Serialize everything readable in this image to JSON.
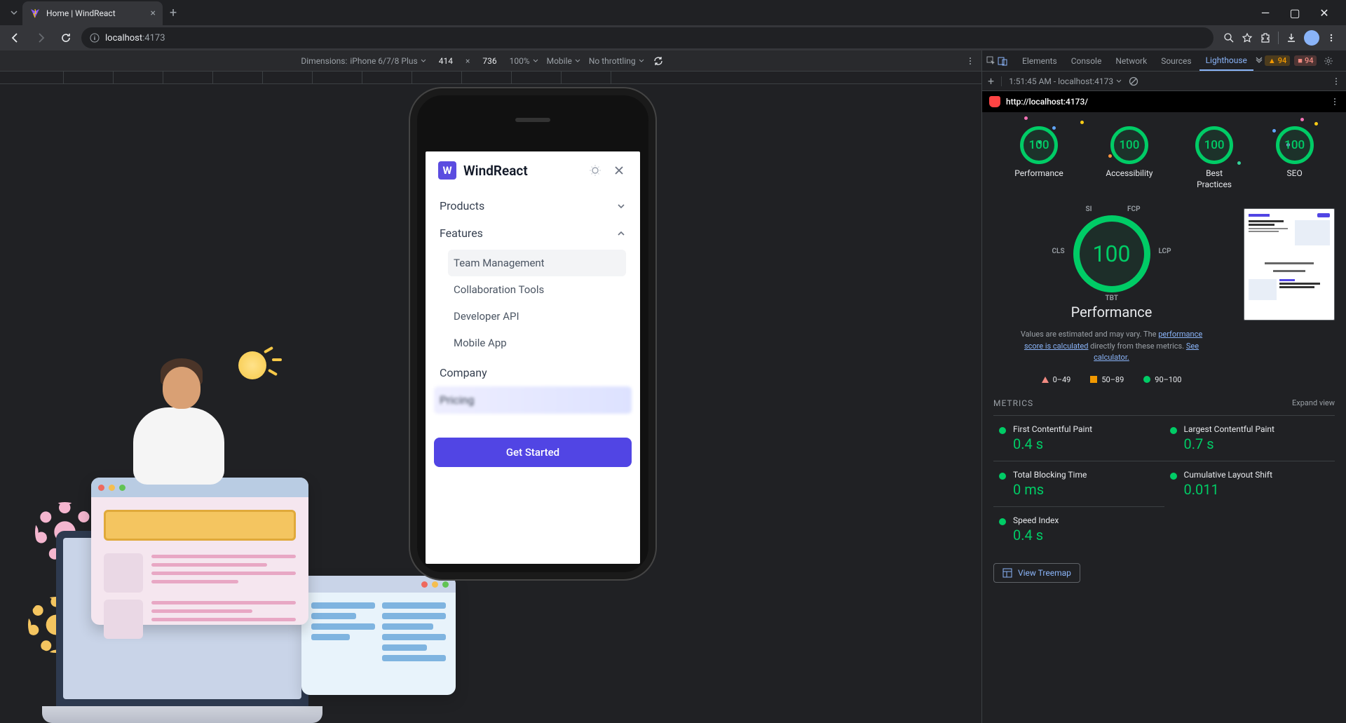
{
  "browser": {
    "tab_title": "Home | WindReact",
    "url_host": "localhost",
    "url_port": ":4173"
  },
  "device_toolbar": {
    "dimensions_label": "Dimensions:",
    "device": "iPhone 6/7/8 Plus",
    "width": "414",
    "height": "736",
    "zoom": "100%",
    "device_type": "Mobile",
    "throttling": "No throttling"
  },
  "app": {
    "logo_letter": "W",
    "name": "WindReact",
    "menu": {
      "products": "Products",
      "features": "Features",
      "features_sub": {
        "team": "Team Management",
        "collab": "Collaboration Tools",
        "api": "Developer API",
        "mobile": "Mobile App"
      },
      "company": "Company",
      "pricing": "Pricing"
    },
    "cta": "Get Started"
  },
  "devtools": {
    "tabs": {
      "elements": "Elements",
      "console": "Console",
      "network": "Network",
      "sources": "Sources",
      "lighthouse": "Lighthouse"
    },
    "warn_count": "94",
    "err_count": "94",
    "lh_timestamp": "1:51:45 AM - localhost:4173",
    "lh_url": "http://localhost:4173/"
  },
  "lighthouse": {
    "gauges": {
      "performance": {
        "score": "100",
        "label": "Performance"
      },
      "accessibility": {
        "score": "100",
        "label": "Accessibility"
      },
      "best_practices": {
        "score": "100",
        "label": "Best\nPractices"
      },
      "seo": {
        "score": "100",
        "label": "SEO"
      }
    },
    "big_gauge_score": "100",
    "big_gauge_title": "Performance",
    "axis": {
      "si": "SI",
      "fcp": "FCP",
      "cls": "CLS",
      "lcp": "LCP",
      "tbt": "TBT"
    },
    "desc_pre": "Values are estimated and may vary. The ",
    "desc_link1": "performance score is calculated",
    "desc_mid": " directly from these metrics. ",
    "desc_link2": "See calculator.",
    "legend": {
      "low": "0–49",
      "mid": "50–89",
      "high": "90–100"
    },
    "metrics_heading": "METRICS",
    "expand": "Expand view",
    "metrics": {
      "fcp": {
        "name": "First Contentful Paint",
        "value": "0.4 s"
      },
      "lcp": {
        "name": "Largest Contentful Paint",
        "value": "0.7 s"
      },
      "tbt": {
        "name": "Total Blocking Time",
        "value": "0 ms"
      },
      "cls": {
        "name": "Cumulative Layout Shift",
        "value": "0.011"
      },
      "si": {
        "name": "Speed Index",
        "value": "0.4 s"
      }
    },
    "treemap": "View Treemap"
  }
}
